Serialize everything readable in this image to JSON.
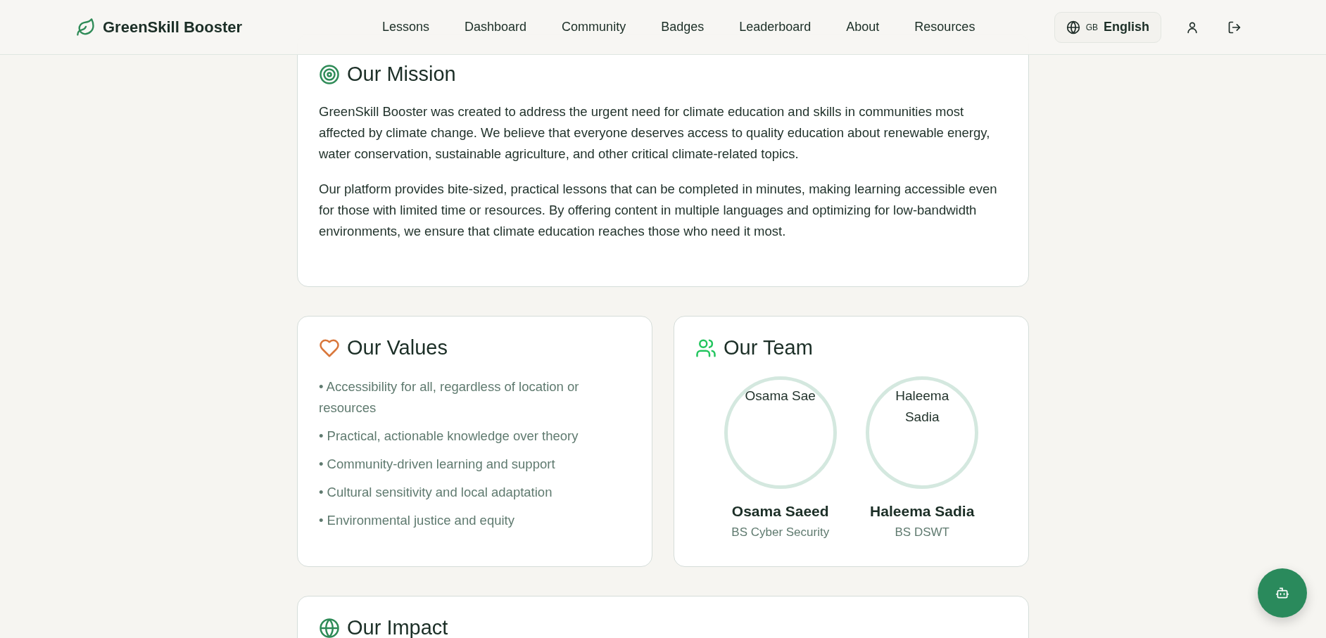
{
  "header": {
    "brand": "GreenSkill Booster",
    "nav": [
      {
        "label": "Lessons"
      },
      {
        "label": "Dashboard"
      },
      {
        "label": "Community"
      },
      {
        "label": "Badges"
      },
      {
        "label": "Leaderboard"
      },
      {
        "label": "About"
      },
      {
        "label": "Resources"
      }
    ],
    "language": {
      "flag": "GB",
      "label": "English"
    }
  },
  "mission": {
    "title": "Our Mission",
    "paragraphs": [
      "GreenSkill Booster was created to address the urgent need for climate education and skills in communities most affected by climate change. We believe that everyone deserves access to quality education about renewable energy, water conservation, sustainable agriculture, and other critical climate-related topics.",
      "Our platform provides bite-sized, practical lessons that can be completed in minutes, making learning accessible even for those with limited time or resources. By offering content in multiple languages and optimizing for low-bandwidth environments, we ensure that climate education reaches those who need it most."
    ]
  },
  "values": {
    "title": "Our Values",
    "items": [
      "• Accessibility for all, regardless of location or resources",
      "• Practical, actionable knowledge over theory",
      "• Community-driven learning and support",
      "• Cultural sensitivity and local adaptation",
      "• Environmental justice and equity"
    ]
  },
  "team": {
    "title": "Our Team",
    "members": [
      {
        "avatar_alt": "Osama Sae",
        "name": "Osama Saeed",
        "role": "BS Cyber Security"
      },
      {
        "avatar_alt": "Haleema Sadia",
        "name": "Haleema Sadia",
        "role": "BS DSWT"
      }
    ]
  },
  "impact": {
    "title": "Our Impact"
  }
}
